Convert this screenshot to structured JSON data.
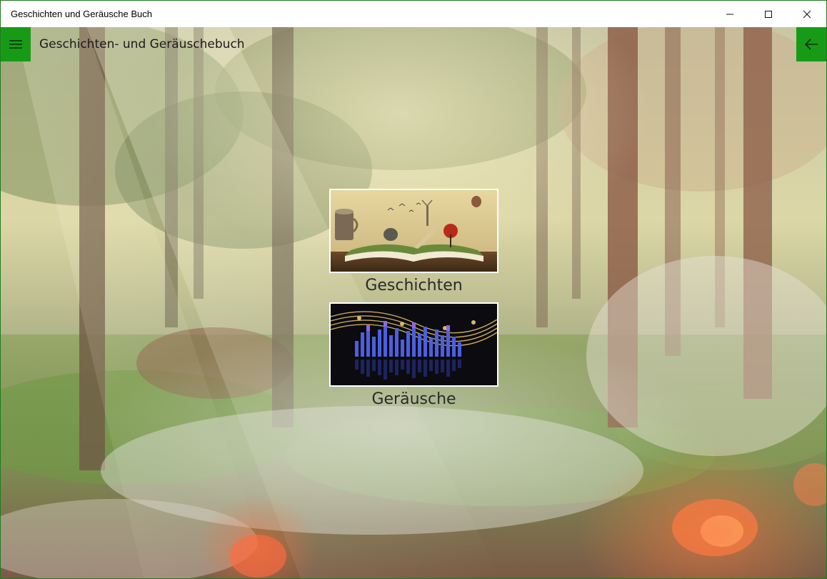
{
  "window": {
    "title": "Geschichten und Geräusche Buch"
  },
  "appbar": {
    "title": "Geschichten- und Geräuschebuch",
    "menu_icon": "hamburger-icon",
    "back_icon": "back-arrow-icon",
    "accent_color": "#179b17"
  },
  "tiles": [
    {
      "label": "Geschichten",
      "image": "open-book-landscape-image"
    },
    {
      "label": "Geräusche",
      "image": "music-equalizer-image"
    }
  ]
}
